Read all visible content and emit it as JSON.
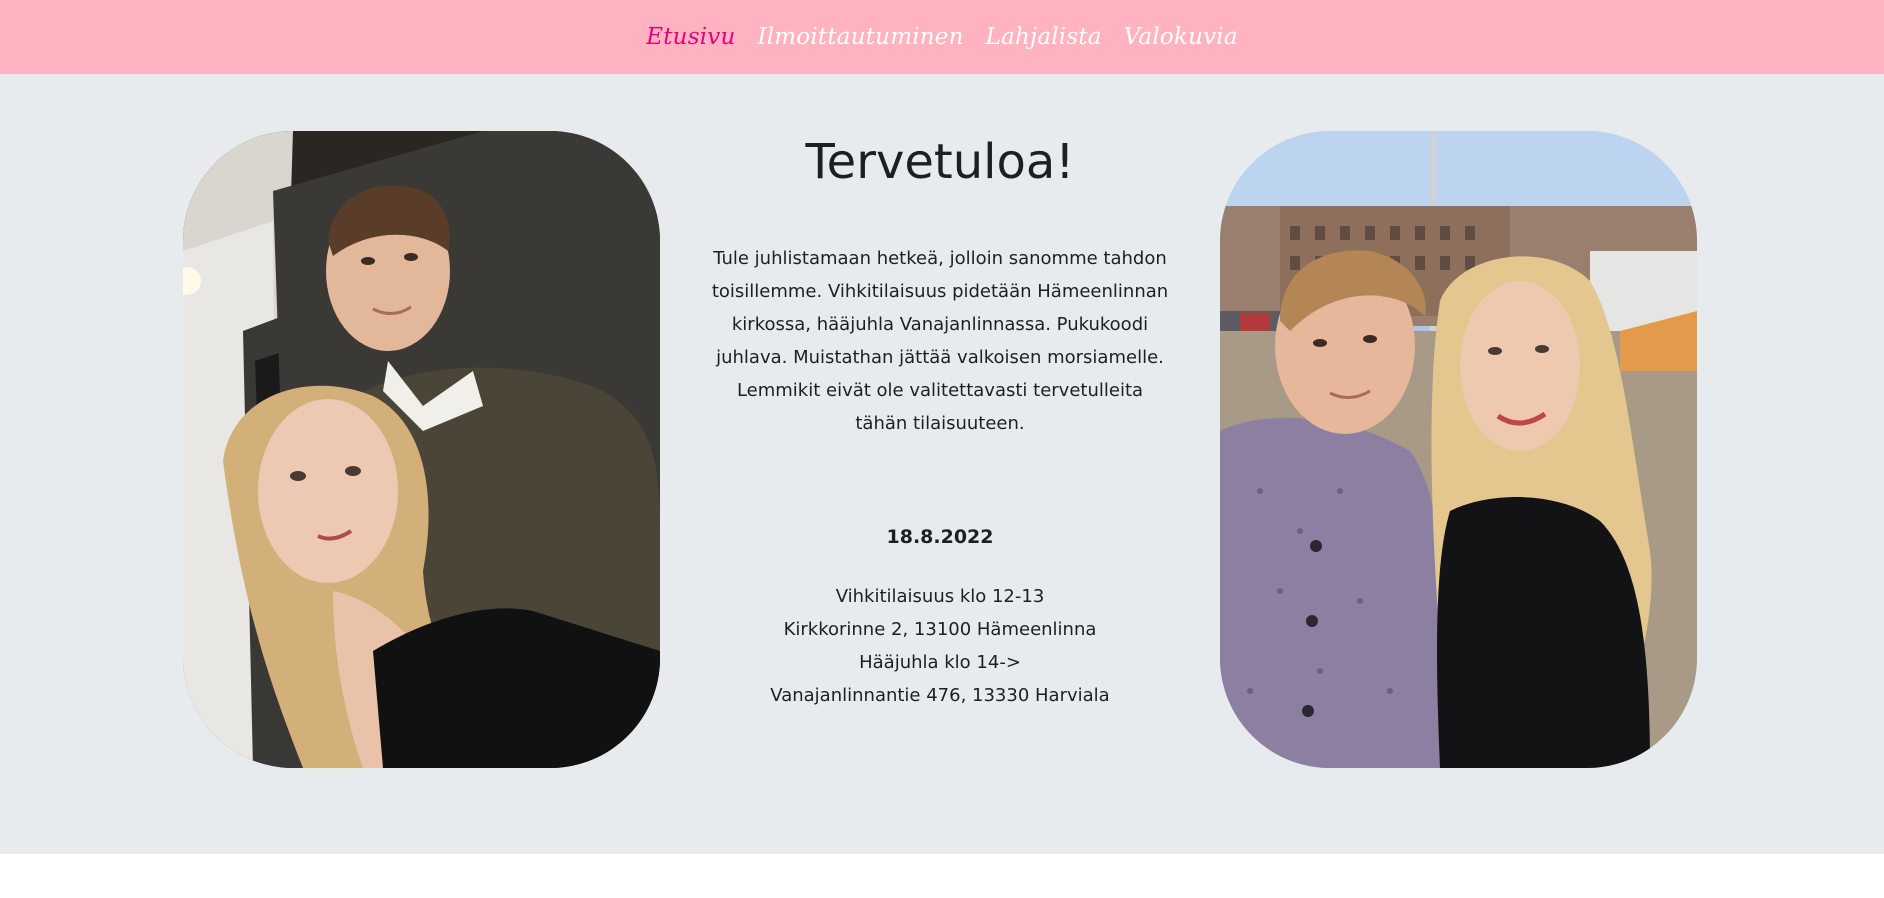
{
  "nav": {
    "items": [
      {
        "label": "Etusivu",
        "active": true
      },
      {
        "label": "Ilmoittautuminen",
        "active": false
      },
      {
        "label": "Lahjalista",
        "active": false
      },
      {
        "label": "Valokuvia",
        "active": false
      }
    ]
  },
  "main": {
    "title": "Tervetuloa!",
    "intro": "Tule juhlistamaan hetkeä, jolloin sanomme tahdon toisillemme. Vihkitilaisuus pidetään Hämeenlinnan kirkossa, hääjuhla Vanajanlinnassa. Pukukoodi juhlava. Muistathan jättää valkoisen morsiamelle. Lemmikit eivät ole valitettavasti tervetulleita tähän tilaisuuteen.",
    "date": "18.8.2022",
    "details": [
      "Vihkitilaisuus klo 12-13",
      "Kirkkorinne 2, 13100 Hämeenlinna",
      "Hääjuhla klo 14->",
      "Vanajanlinnantie 476, 13330 Harviala"
    ]
  },
  "photos": {
    "left": "couple-selfie-indoor-photo",
    "right": "couple-selfie-outdoor-photo"
  },
  "colors": {
    "navbar_bg": "#ffb3c0",
    "nav_active": "#e6007e",
    "nav_text": "#ffffff",
    "main_bg": "#e8ebee",
    "text": "#1c2024"
  }
}
